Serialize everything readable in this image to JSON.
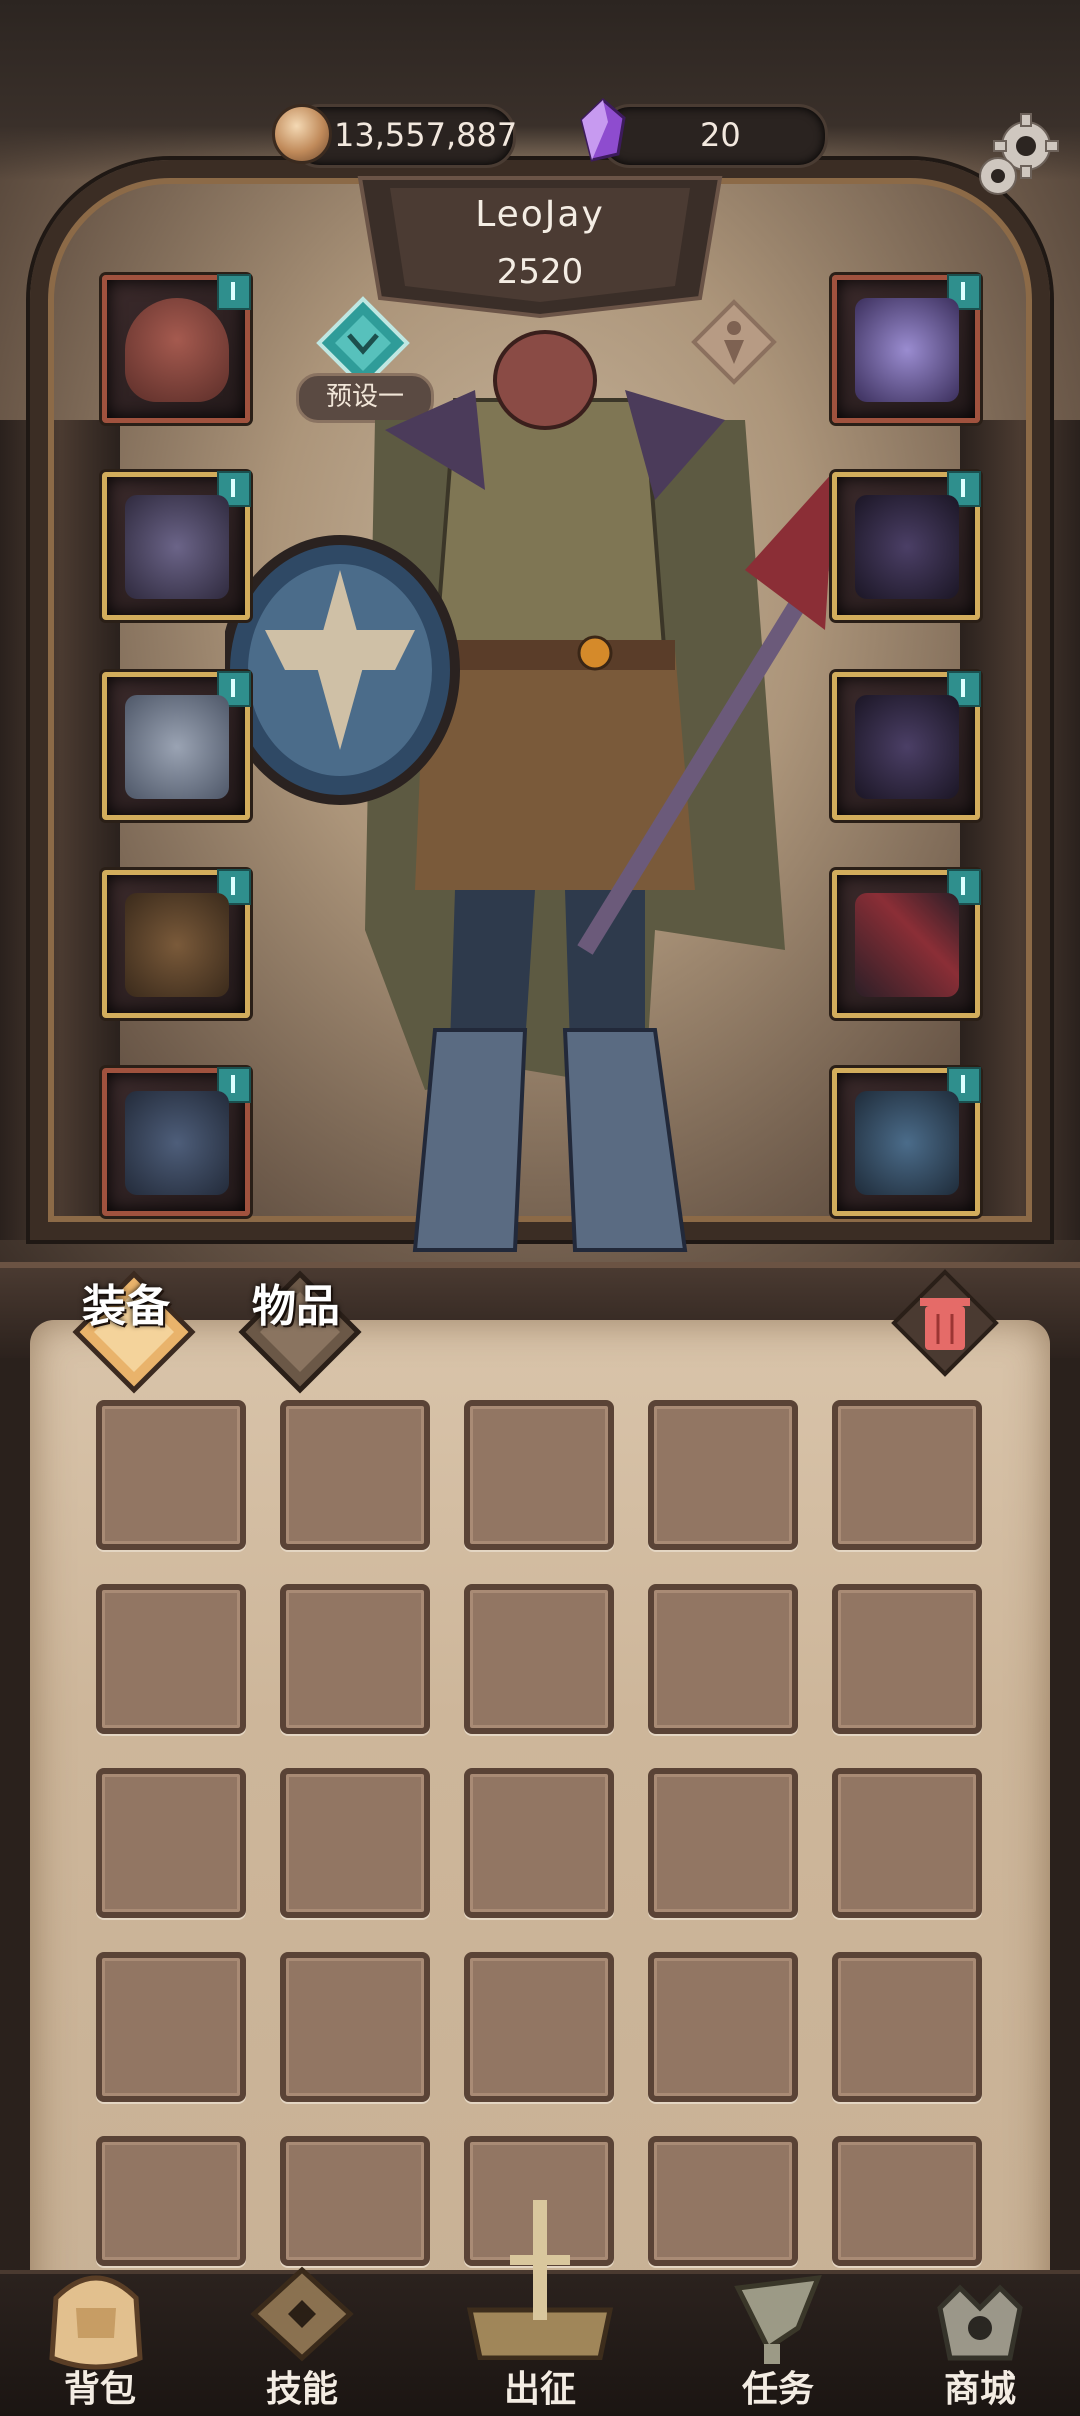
{
  "currency": {
    "coins": "13,557,887",
    "gems": "20"
  },
  "player": {
    "name": "LeoJay",
    "power": "2520"
  },
  "preset": {
    "label": "预设一"
  },
  "tabs": [
    {
      "label": "装备"
    },
    {
      "label": "物品"
    }
  ],
  "bottom_nav": [
    {
      "label": "背包",
      "icon": "backpack-icon"
    },
    {
      "label": "技能",
      "icon": "skill-scroll-icon"
    },
    {
      "label": "出征",
      "icon": "expedition-sword-icon"
    },
    {
      "label": "任务",
      "icon": "quest-horn-icon"
    },
    {
      "label": "商城",
      "icon": "shop-crown-icon"
    }
  ],
  "equipment": {
    "left": [
      "helmet",
      "chest-armor",
      "gauntlet",
      "belt",
      "boots"
    ],
    "right": [
      "amulet",
      "ring",
      "ring",
      "weapon",
      "shield"
    ]
  },
  "colors": {
    "accent_teal": "#2f8f8d",
    "slot_gold": "#b8975a",
    "parchment": "#cdb69a"
  }
}
